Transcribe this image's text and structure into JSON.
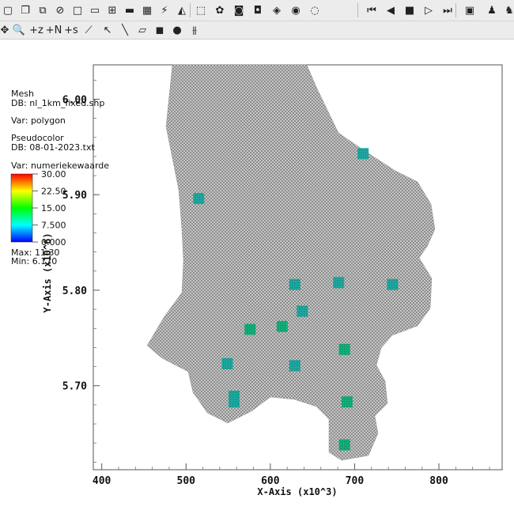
{
  "toolbar_row1": [
    {
      "name": "new-window-icon",
      "glyph": "▢"
    },
    {
      "name": "copy-window-icon",
      "glyph": "❐"
    },
    {
      "name": "clone-window-icon",
      "glyph": "⧉"
    },
    {
      "name": "delete-window-icon",
      "glyph": "⊘"
    },
    {
      "name": "layout-1x1-icon",
      "glyph": "□"
    },
    {
      "name": "layout-1x2-icon",
      "glyph": "▭"
    },
    {
      "name": "layout-2x2-icon",
      "glyph": "⊞"
    },
    {
      "name": "layout-1x3-icon",
      "glyph": "▬"
    },
    {
      "name": "layout-3x3-icon",
      "glyph": "▦"
    },
    {
      "name": "lock-view-icon",
      "glyph": "⚡"
    },
    {
      "name": "lock-time-icon",
      "glyph": "◭"
    },
    {
      "name": "view-3d-box-icon",
      "glyph": "⬚"
    },
    {
      "name": "invert-background-icon",
      "glyph": "✿"
    },
    {
      "name": "save-image-icon",
      "glyph": "◙"
    },
    {
      "name": "camera-icon",
      "glyph": "◘"
    },
    {
      "name": "camera-rotate-icon",
      "glyph": "◈"
    },
    {
      "name": "camera-multi-icon",
      "glyph": "◉"
    },
    {
      "name": "camera-disabled-icon",
      "glyph": "◌"
    },
    {
      "name": "rewind-icon",
      "glyph": "⏮"
    },
    {
      "name": "step-back-icon",
      "glyph": "◀"
    },
    {
      "name": "stop-icon",
      "glyph": "■"
    },
    {
      "name": "play-icon",
      "glyph": "▷"
    },
    {
      "name": "step-forward-icon",
      "glyph": "⏭"
    },
    {
      "name": "presentation-icon",
      "glyph": "▣"
    },
    {
      "name": "user-icon",
      "glyph": "♟"
    },
    {
      "name": "people-icon",
      "glyph": "♞"
    }
  ],
  "toolbar_row2": [
    {
      "name": "navigate-icon",
      "glyph": "✥"
    },
    {
      "name": "zoom-icon",
      "glyph": "🔍"
    },
    {
      "name": "zone-pick-icon",
      "glyph": "+z"
    },
    {
      "name": "node-pick-icon",
      "glyph": "+N"
    },
    {
      "name": "spreadsheet-pick-icon",
      "glyph": "+s"
    },
    {
      "name": "curve-pick-icon",
      "glyph": "⟋"
    },
    {
      "name": "lineout-icon",
      "glyph": "↖"
    },
    {
      "name": "line-tool-icon",
      "glyph": "╲"
    },
    {
      "name": "plane-tool-icon",
      "glyph": "▱"
    },
    {
      "name": "box-tool-icon",
      "glyph": "◼"
    },
    {
      "name": "sphere-tool-icon",
      "glyph": "●"
    },
    {
      "name": "axis-restrict-icon",
      "glyph": "⫵"
    }
  ],
  "legend": {
    "mesh_title": "Mesh",
    "mesh_db": "DB: nl_1km_fixed.shp",
    "mesh_var": "Var: polygon",
    "pc_title": "Pseudocolor",
    "pc_db": "DB: 08-01-2023.txt",
    "pc_var": "Var: numeriekewaarde",
    "ticks": [
      "30.00",
      "22.50",
      "15.00",
      "7.500",
      "0.000"
    ],
    "max": "Max:  11.30",
    "min": "Min:  6.170"
  },
  "colors": {
    "mesh_fill": "#a4a4a4",
    "frame": "#555555",
    "cell_a": "#1ea9a1",
    "cell_b": "#12b07c"
  },
  "chart_data": {
    "type": "scatter",
    "xlabel": "X-Axis (x10^3)",
    "ylabel": "Y-Axis (x10^6)",
    "xticks": [
      400,
      500,
      600,
      700,
      800
    ],
    "yticks": [
      "5.70",
      "5.80",
      "5.90",
      "6.00"
    ],
    "xlim": [
      390,
      875
    ],
    "ylim": [
      5.612,
      6.036
    ],
    "value_range": [
      0,
      30
    ],
    "points": [
      {
        "x": 710,
        "y": 5.943,
        "value": 7.9
      },
      {
        "x": 515,
        "y": 5.896,
        "value": 10.2
      },
      {
        "x": 629,
        "y": 5.806,
        "value": 8.4
      },
      {
        "x": 681,
        "y": 5.808,
        "value": 7.6
      },
      {
        "x": 745,
        "y": 5.806,
        "value": 6.9
      },
      {
        "x": 638,
        "y": 5.778,
        "value": 10.0
      },
      {
        "x": 576,
        "y": 5.759,
        "value": 10.6
      },
      {
        "x": 614,
        "y": 5.762,
        "value": 10.8
      },
      {
        "x": 688,
        "y": 5.738,
        "value": 11.3
      },
      {
        "x": 549,
        "y": 5.723,
        "value": 7.2
      },
      {
        "x": 629,
        "y": 5.721,
        "value": 6.2
      },
      {
        "x": 557,
        "y": 5.689,
        "value": 8.1
      },
      {
        "x": 557,
        "y": 5.683,
        "value": 9.8
      },
      {
        "x": 691,
        "y": 5.683,
        "value": 10.9
      },
      {
        "x": 688,
        "y": 5.638,
        "value": 11.1
      }
    ]
  }
}
